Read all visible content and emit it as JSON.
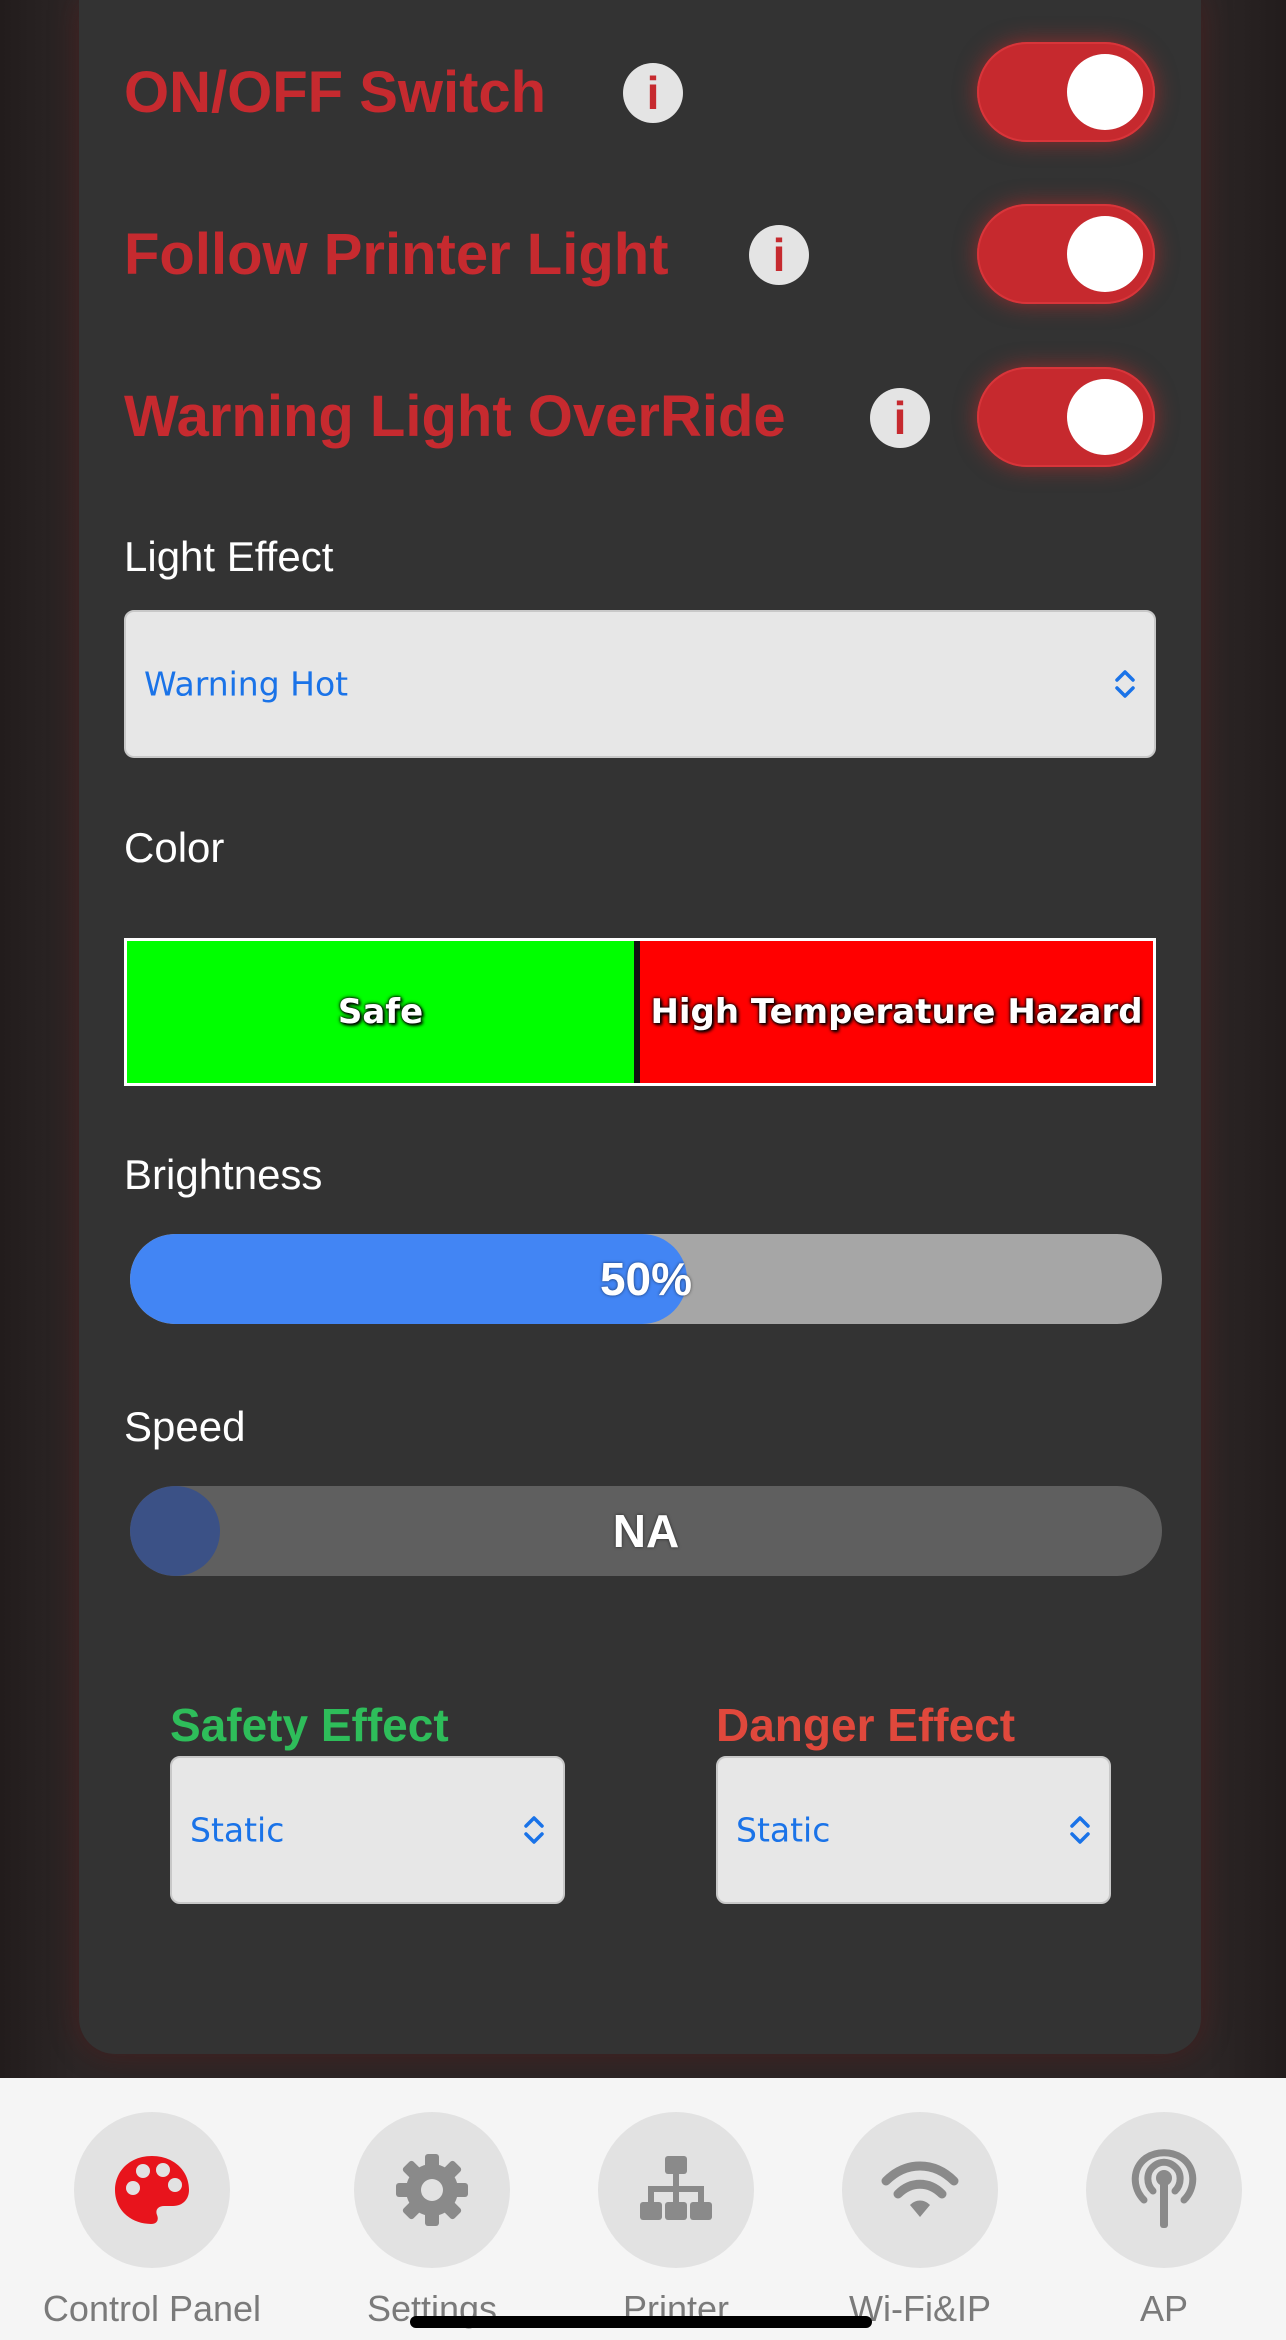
{
  "controls": {
    "on_off": {
      "label": "ON/OFF Switch",
      "info": "i",
      "on": true
    },
    "follow_printer": {
      "label": "Follow Printer Light",
      "info": "i",
      "on": true
    },
    "warning_override": {
      "label": "Warning Light OverRide",
      "info": "i",
      "on": true
    }
  },
  "light_effect": {
    "label": "Light Effect",
    "value": "Warning Hot"
  },
  "color": {
    "label": "Color",
    "segments": [
      {
        "text": "Safe",
        "color": "#00ff00"
      },
      {
        "text": "High Temperature Hazard",
        "color": "#ff0000"
      }
    ]
  },
  "brightness": {
    "label": "Brightness",
    "value_text": "50%",
    "fraction": 0.5,
    "fill_color": "#4285f4"
  },
  "speed": {
    "label": "Speed",
    "value_text": "NA",
    "fraction": 0
  },
  "safety_effect": {
    "label": "Safety Effect",
    "value": "Static",
    "color": "#2ebd5a"
  },
  "danger_effect": {
    "label": "Danger Effect",
    "value": "Static",
    "color": "#e0483c"
  },
  "tabs": [
    {
      "label": "Control Panel",
      "icon": "palette-icon",
      "active": true
    },
    {
      "label": "Settings",
      "icon": "gear-icon",
      "active": false
    },
    {
      "label": "Printer",
      "icon": "network-icon",
      "active": false
    },
    {
      "label": "Wi-Fi&IP",
      "icon": "wifi-icon",
      "active": false
    },
    {
      "label": "AP",
      "icon": "antenna-icon",
      "active": false
    }
  ],
  "accent_color": "#c62a2f"
}
